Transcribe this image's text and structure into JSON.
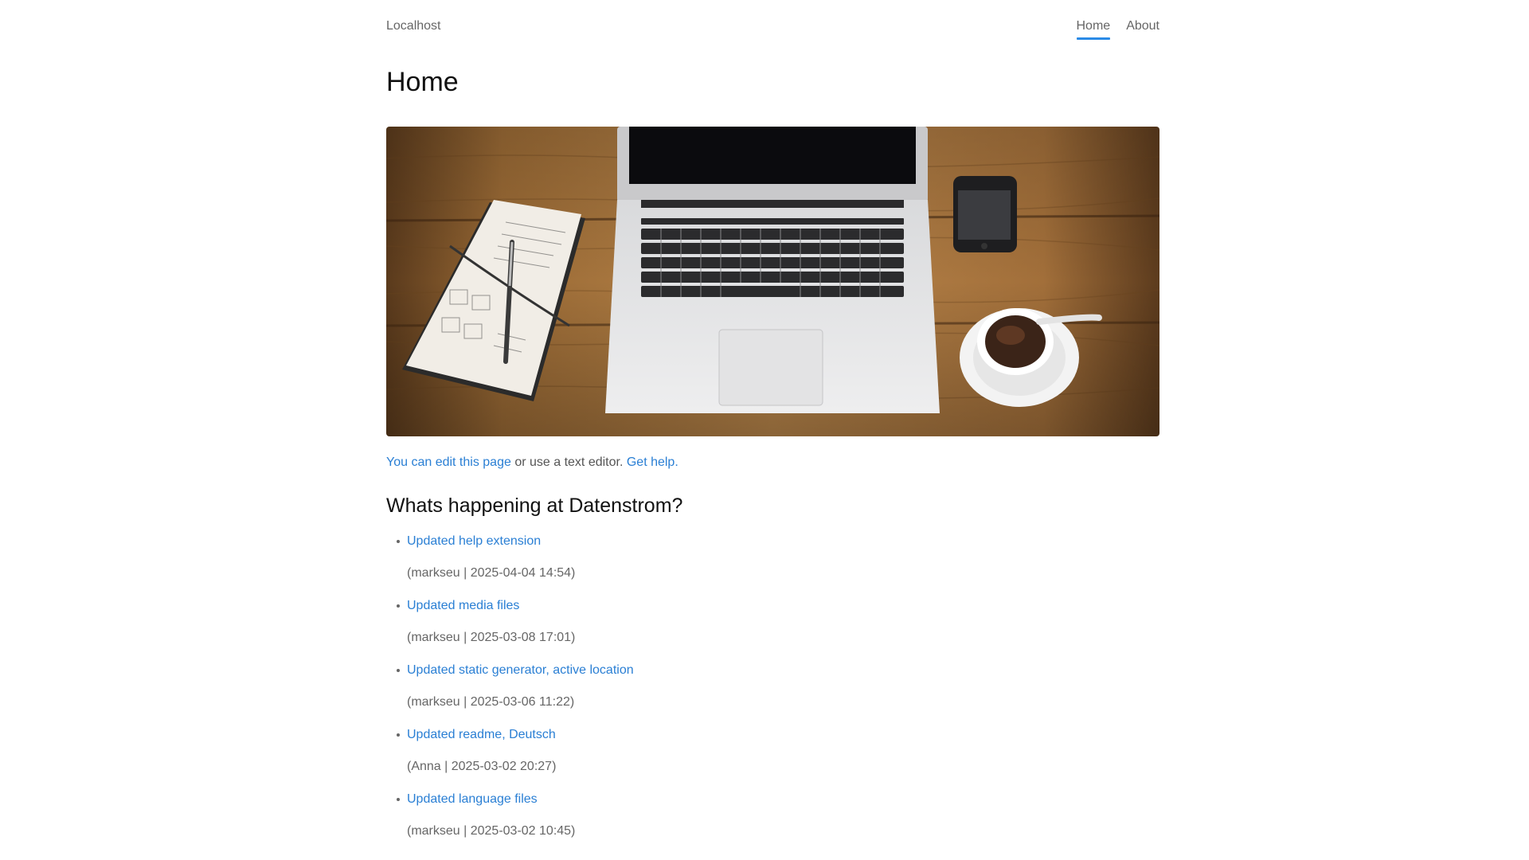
{
  "header": {
    "site_title": "Localhost",
    "nav": [
      {
        "label": "Home",
        "active": true
      },
      {
        "label": "About",
        "active": false
      }
    ]
  },
  "page": {
    "title": "Home"
  },
  "intro": {
    "edit_link": "You can edit this page",
    "middle_text": " or use a text editor. ",
    "help_link": "Get help."
  },
  "section": {
    "heading": "Whats happening at Datenstrom?"
  },
  "changes": [
    {
      "title": "Updated help extension",
      "meta": "(markseu | 2025-04-04 14:54)"
    },
    {
      "title": "Updated media files",
      "meta": "(markseu | 2025-03-08 17:01)"
    },
    {
      "title": "Updated static generator, active location",
      "meta": "(markseu | 2025-03-06 11:22)"
    },
    {
      "title": "Updated readme, Deutsch",
      "meta": "(Anna | 2025-03-02 20:27)"
    },
    {
      "title": "Updated language files",
      "meta": "(markseu | 2025-03-02 10:45)"
    }
  ],
  "colors": {
    "accent": "#2a8ae6",
    "link": "#2a7fd4"
  }
}
